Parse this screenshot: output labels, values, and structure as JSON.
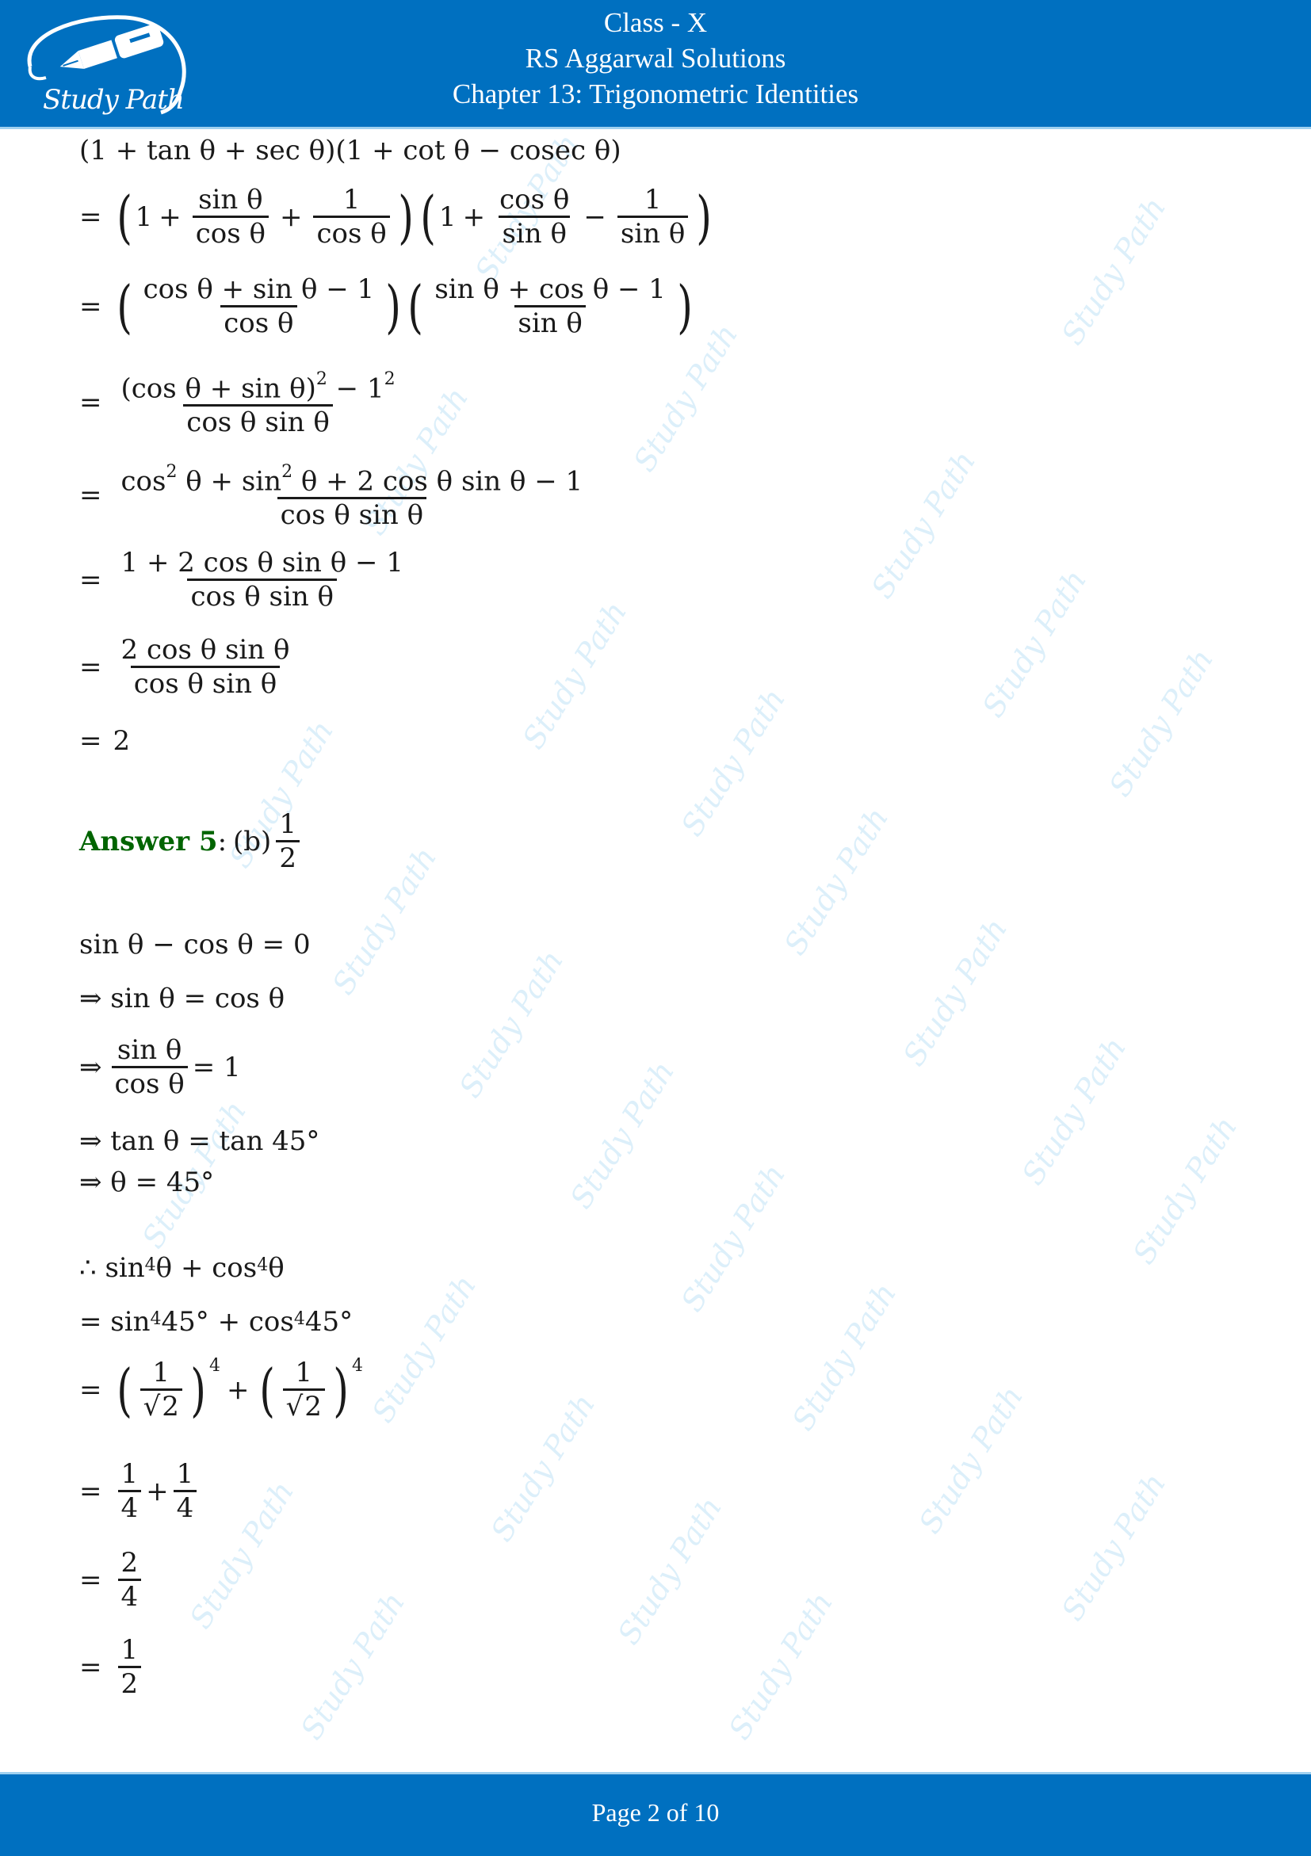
{
  "header": {
    "logo_text": "Study Path",
    "class_title": "Class - X",
    "book_title": "RS Aggarwal Solutions",
    "chapter_title": "Chapter 13: Trigonometric Identities"
  },
  "colors": {
    "header_bg": "#0070c0",
    "answer_green": "#006400",
    "watermark": "#d4ecf9"
  },
  "watermark_text": "Study Path",
  "question4_work": {
    "line1": "(1 + tan θ + sec θ)(1 + cot θ − cosec θ)",
    "line2": {
      "eq": "=",
      "left": {
        "one": "1",
        "plus1": "+",
        "f1_num": "sin θ",
        "f1_den": "cos θ",
        "plus2": "+",
        "f2_num": "1",
        "f2_den": "cos θ"
      },
      "right": {
        "one": "1",
        "plus1": "+",
        "f1_num": "cos θ",
        "f1_den": "sin θ",
        "minus": "−",
        "f2_num": "1",
        "f2_den": "sin θ"
      }
    },
    "line3": {
      "eq": "=",
      "f1_num": "cos θ + sin θ − 1",
      "f1_den": "cos θ",
      "f2_num": "sin θ + cos θ − 1",
      "f2_den": "sin θ"
    },
    "line4": {
      "eq": "=",
      "num_base": "(cos θ + sin θ)",
      "num_exp": "2",
      "num_mid": " − 1",
      "num_exp2": "2",
      "den": "cos θ sin θ"
    },
    "line5": {
      "eq": "=",
      "num_a": "cos",
      "num_a_exp": "2",
      "num_b": " θ + sin",
      "num_b_exp": "2",
      "num_c": " θ + 2 cos θ sin θ − 1",
      "den": "cos θ sin θ"
    },
    "line6": {
      "eq": "=",
      "num": "1 + 2 cos θ sin θ − 1",
      "den": "cos θ sin θ"
    },
    "line7": {
      "eq": "=",
      "num": "2 cos θ sin θ",
      "den": "cos θ sin θ"
    },
    "line8": {
      "eq": "=",
      "value": "2"
    }
  },
  "answer5": {
    "label": "Answer 5",
    "colon": ":",
    "option": "(b)",
    "frac_num": "1",
    "frac_den": "2"
  },
  "question5_work": {
    "line1": "sin θ − cos θ = 0",
    "line2": "⇒ sin θ = cos θ",
    "line3": {
      "arrow": "⇒",
      "num": "sin θ",
      "den": "cos θ",
      "rhs": "= 1"
    },
    "line4": "⇒ tan θ = tan 45°",
    "line5": "⇒ θ = 45°",
    "line6": {
      "prefix": "∴ sin",
      "exp1": "4",
      "mid": " θ + cos",
      "exp2": "4",
      "suffix": " θ"
    },
    "line7": {
      "prefix": "= sin",
      "exp1": "4",
      "mid": " 45° + cos",
      "exp2": "4",
      "suffix": " 45°"
    },
    "line8": {
      "eq": "=",
      "num": "1",
      "den_root": "2",
      "exp": "4",
      "plus": "+"
    },
    "line9": {
      "eq": "=",
      "f1_num": "1",
      "f1_den": "4",
      "plus": "+",
      "f2_num": "1",
      "f2_den": "4"
    },
    "line10": {
      "eq": "=",
      "num": "2",
      "den": "4"
    },
    "line11": {
      "eq": "=",
      "num": "1",
      "den": "2"
    }
  },
  "footer": {
    "page_label": "Page 2 of 10",
    "current_page": 2,
    "total_pages": 10
  }
}
